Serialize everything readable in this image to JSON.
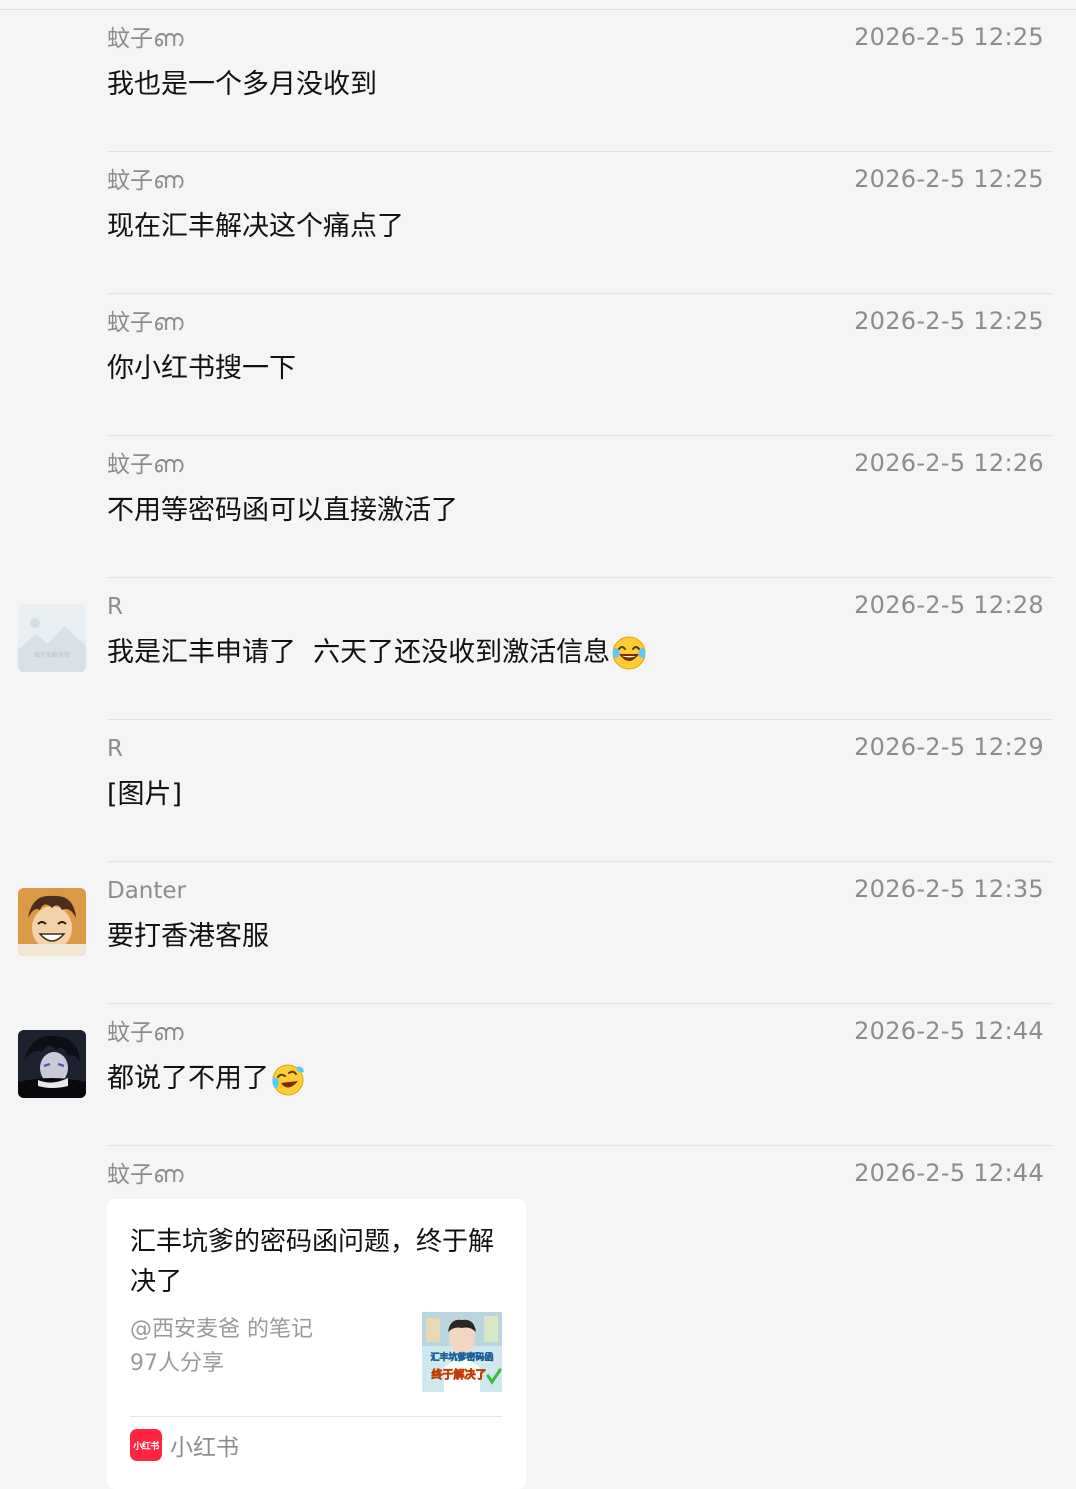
{
  "messages": [
    {
      "sender": "蚊子ണ",
      "time": "2026-2-5 12:25",
      "text": "我也是一个多月没收到"
    },
    {
      "sender": "蚊子ണ",
      "time": "2026-2-5 12:25",
      "text": "现在汇丰解决这个痛点了"
    },
    {
      "sender": "蚊子ണ",
      "time": "2026-2-5 12:25",
      "text": "你小红书搜一下"
    },
    {
      "sender": "蚊子ണ",
      "time": "2026-2-5 12:26",
      "text": "不用等密码函可以直接激活了"
    },
    {
      "sender": "R",
      "time": "2026-2-5 12:28",
      "text": "我是汇丰申请了  六天了还没收到激活信息",
      "emoji": "laughing-tears-emoji",
      "avatar": "placeholder-image-avatar",
      "avatar_caption": "图片加载失败"
    },
    {
      "sender": "R",
      "time": "2026-2-5 12:29",
      "text": "[图片]"
    },
    {
      "sender": "Danter",
      "time": "2026-2-5 12:35",
      "text": "要打香港客服",
      "avatar": "anime-boy-avatar"
    },
    {
      "sender": "蚊子ണ",
      "time": "2026-2-5 12:44",
      "text": "都说了不用了",
      "emoji": "crying-laughing-emoji",
      "avatar": "dark-anime-avatar"
    },
    {
      "sender": "蚊子ണ",
      "time": "2026-2-5 12:44"
    }
  ],
  "share_card": {
    "title": "汇丰坑爹的密码函问题，终于解决了",
    "author": "@西安麦爸 的笔记",
    "shares": "97人分享",
    "thumb_text_1": "汇丰坑爹密码函",
    "thumb_text_2": "终于解决了",
    "source_logo_text": "小红书",
    "source_label": "小红书"
  },
  "colors": {
    "background": "#f5f5f5",
    "meta_text": "#8c8c8c",
    "message_text": "#111111",
    "divider": "#e3e3e3",
    "xhs_red": "#ff2442"
  }
}
